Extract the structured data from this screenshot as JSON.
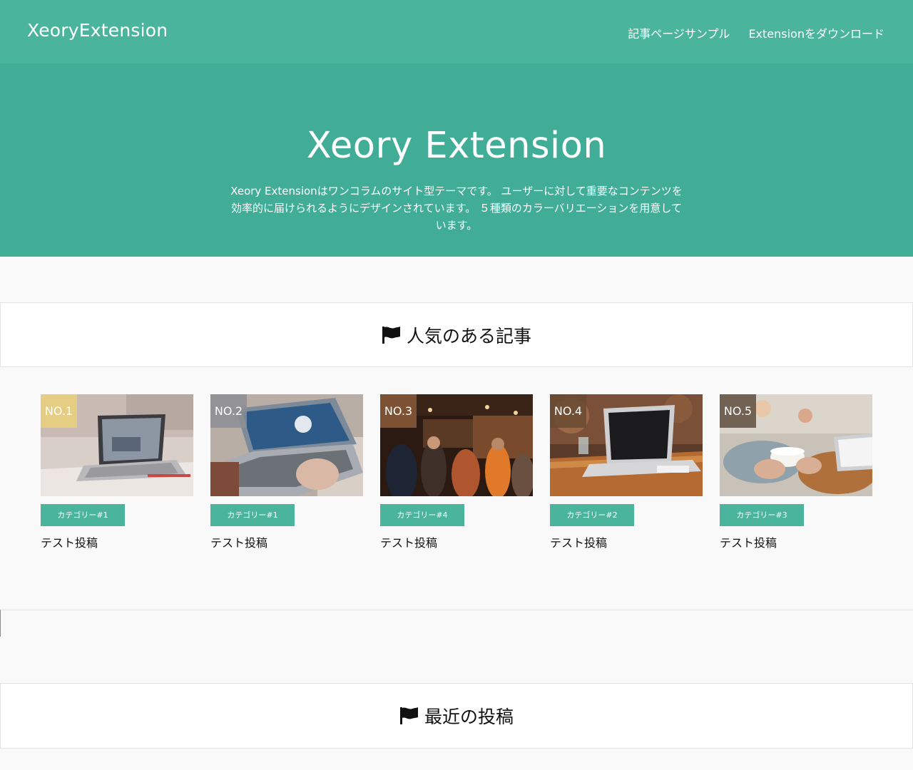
{
  "header": {
    "logo": "XeoryExtension",
    "nav": [
      {
        "label": "記事ページサンプル"
      },
      {
        "label": "Extensionをダウンロード"
      }
    ]
  },
  "hero": {
    "title": "Xeory Extension",
    "description": "Xeory Extensionはワンコラムのサイト型テーマです。 ユーザーに対して重要なコンテンツを効率的に届けられるようにデザインされています。 ５種類のカラーバリエーションを用意しています。"
  },
  "popular": {
    "heading": "人気のある記事",
    "icon": "flag-icon",
    "items": [
      {
        "rank": "NO.1",
        "category": "カテゴリー#1",
        "title": "テスト投稿",
        "rank_color": "#e8cf7e"
      },
      {
        "rank": "NO.2",
        "category": "カテゴリー#1",
        "title": "テスト投稿",
        "rank_color": "#8e8f93"
      },
      {
        "rank": "NO.3",
        "category": "カテゴリー#4",
        "title": "テスト投稿",
        "rank_color": "#8a5a3a"
      },
      {
        "rank": "NO.4",
        "category": "カテゴリー#2",
        "title": "テスト投稿",
        "rank_color": "#6a4a32"
      },
      {
        "rank": "NO.5",
        "category": "カテゴリー#3",
        "title": "テスト投稿",
        "rank_color": "#5e4e3e"
      }
    ]
  },
  "recent": {
    "heading": "最近の投稿",
    "icon": "flag-icon"
  },
  "colors": {
    "header_bg": "#4ab49c",
    "hero_bg": "#42ad97",
    "accent": "#4ab49c"
  }
}
